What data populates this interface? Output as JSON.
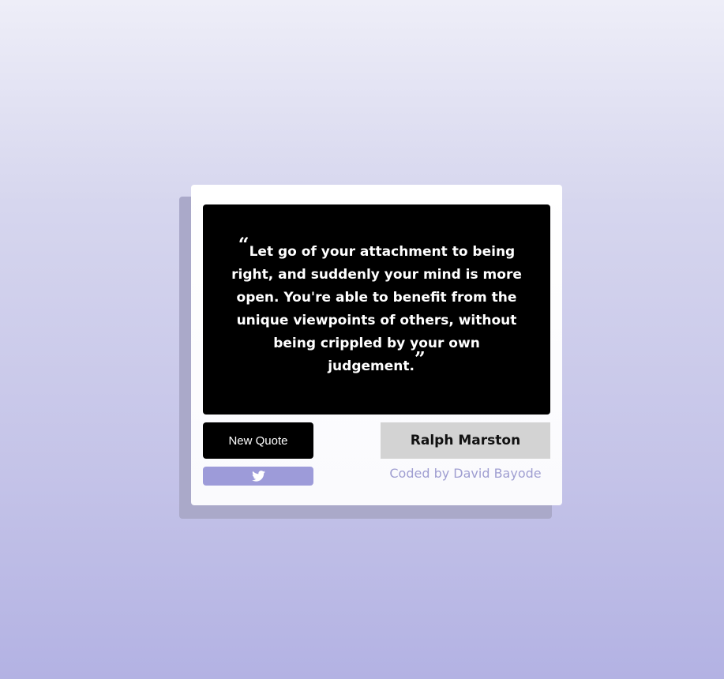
{
  "quote": {
    "open_mark": "“",
    "text": "Let go of your attachment to being right, and suddenly your mind is more open. You're able to benefit from the unique viewpoints of others, without being crippled by your own judgement.",
    "close_mark": "”"
  },
  "author": "Ralph Marston",
  "buttons": {
    "new_quote_label": "New Quote",
    "tweet_icon": "twitter-icon"
  },
  "credit": "Coded by David Bayode",
  "colors": {
    "quote_bg": "#000000",
    "quote_text": "#ffffff",
    "tweet_bg": "#9d9bd9",
    "author_bg": "#d3d3d3",
    "credit_text": "#9f9ed1"
  }
}
